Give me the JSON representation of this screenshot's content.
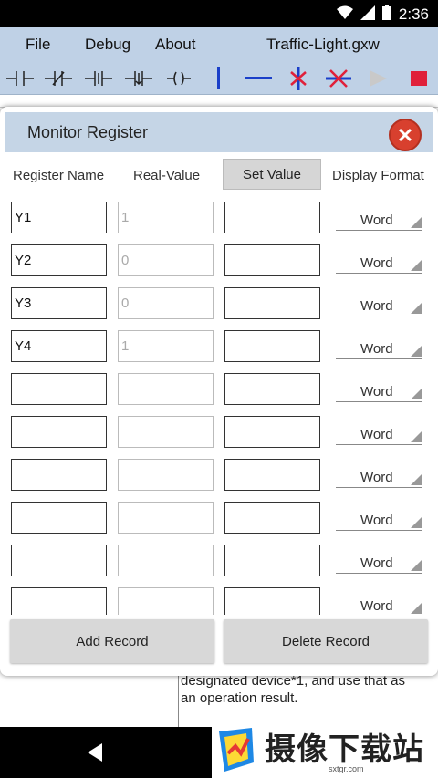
{
  "status_bar": {
    "time": "2:36"
  },
  "menu": {
    "file": "File",
    "debug": "Debug",
    "about": "About",
    "file_name": "Traffic-Light.gxw"
  },
  "toolbar": {
    "tools": [
      "contact-no-icon",
      "contact-nc-icon",
      "contact-rising-icon",
      "contact-falling-icon",
      "coil-icon",
      "vertical-line-icon",
      "horizontal-line-icon",
      "delete-vertical-icon",
      "delete-horizontal-icon",
      "run-icon",
      "stop-icon"
    ]
  },
  "dialog": {
    "title": "Monitor Register",
    "headers": {
      "name": "Register Name",
      "real": "Real-Value",
      "set": "Set Value",
      "format": "Display Format"
    },
    "rows": [
      {
        "name": "Y1",
        "real": "1",
        "set": "",
        "format": "Word"
      },
      {
        "name": "Y2",
        "real": "0",
        "set": "",
        "format": "Word"
      },
      {
        "name": "Y3",
        "real": "0",
        "set": "",
        "format": "Word"
      },
      {
        "name": "Y4",
        "real": "1",
        "set": "",
        "format": "Word"
      },
      {
        "name": "",
        "real": "",
        "set": "",
        "format": "Word"
      },
      {
        "name": "",
        "real": "",
        "set": "",
        "format": "Word"
      },
      {
        "name": "",
        "real": "",
        "set": "",
        "format": "Word"
      },
      {
        "name": "",
        "real": "",
        "set": "",
        "format": "Word"
      },
      {
        "name": "",
        "real": "",
        "set": "",
        "format": "Word"
      },
      {
        "name": "",
        "real": "",
        "set": "",
        "format": "Word"
      }
    ],
    "add_record": "Add Record",
    "delete_record": "Delete Record"
  },
  "background_text": {
    "line1": "designated device*1, and use that as",
    "line2": "an operation result."
  },
  "watermark": {
    "text": "摄像下载站",
    "url": "sxtgr.com"
  },
  "colors": {
    "menubar": "#bfd1e6",
    "title_bar": "#c5d5e6",
    "close": "#d8402e",
    "blue_tool": "#1a3fc9",
    "red_tool": "#e0203a"
  }
}
